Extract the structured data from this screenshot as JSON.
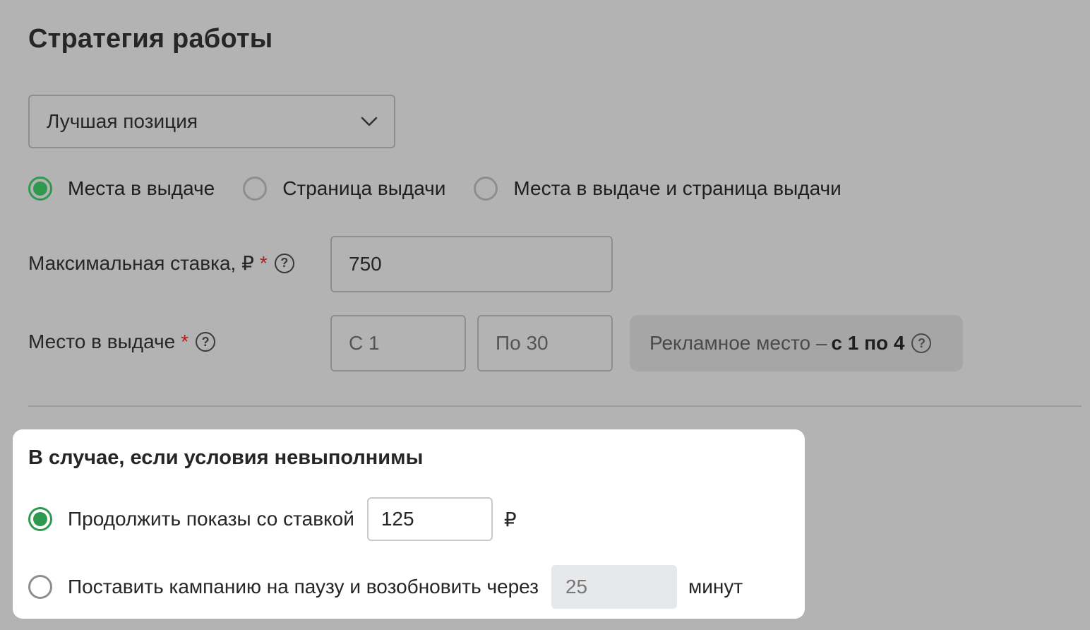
{
  "header": {
    "title": "Стратегия работы"
  },
  "strategy_select": {
    "value": "Лучшая позиция"
  },
  "mode_radios": [
    {
      "label": "Места в выдаче",
      "selected": true
    },
    {
      "label": "Страница выдачи",
      "selected": false
    },
    {
      "label": "Места в выдаче и страница выдачи",
      "selected": false
    }
  ],
  "max_bid": {
    "label": "Максимальная ставка, ₽",
    "required_mark": "*",
    "help": "?",
    "value": "750"
  },
  "position": {
    "label": "Место в выдаче",
    "required_mark": "*",
    "help": "?",
    "from_value": "С 1",
    "to_value": "По 30",
    "info_prefix": "Рекламное место –",
    "info_range": "с 1 по 4",
    "info_help": "?"
  },
  "fallback": {
    "title": "В случае, если условия невыполнимы",
    "continue": {
      "label": "Продолжить показы со ставкой",
      "value": "125",
      "unit": "₽",
      "selected": true
    },
    "pause": {
      "label": "Поставить кампанию на паузу и возобновить через",
      "value": "25",
      "unit": "минут",
      "selected": false
    }
  },
  "colors": {
    "accent": "#2f9a4f",
    "required": "#b11e1e",
    "overlay_bg": "#b3b3b3"
  }
}
